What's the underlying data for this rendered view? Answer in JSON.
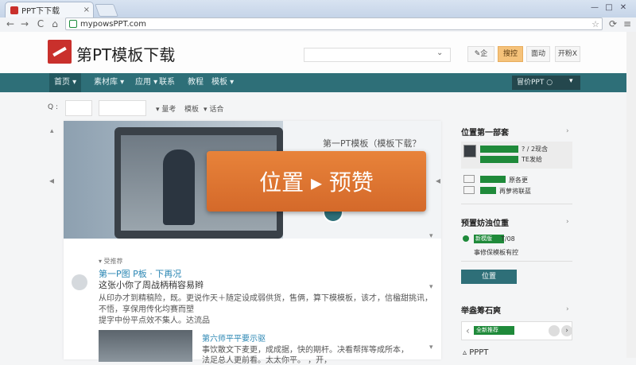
{
  "browser": {
    "tab_title": "PPT下下载",
    "tab_close": "×",
    "url": "mypowsPPT.com",
    "star": "☆",
    "menu": "≡",
    "win_min": "—",
    "win_max": "□",
    "win_close": "✕",
    "back": "←",
    "forward": "→",
    "reload": "C",
    "home": "⌂"
  },
  "header": {
    "logo_text": "第PT模板下载",
    "search_caret": "⌄",
    "buttons": [
      "✎企",
      "搜控",
      "面动",
      "开粉X"
    ]
  },
  "nav": {
    "items": [
      "首页 ▾",
      "素材库 ▾",
      "应用 ▾",
      "联系",
      "教程",
      "模板 ▾"
    ],
    "user": "冒价PPT ○"
  },
  "filter": {
    "label": "Q :",
    "options": [
      "▾ 量考",
      "模板",
      "▾ 话合"
    ]
  },
  "hero": {
    "title": "第一PT模板（模板下载？",
    "overlay_text": "位置 ▸ 预赞",
    "prev": "◂",
    "next": "◂",
    "top_arrow": "▴",
    "bottom_arrow": "▾"
  },
  "post": {
    "section_label": "▾ 受推荐",
    "title": "第一P图 P板 · 下再况",
    "subtitle": "这张小你了周战柄稍容易辫",
    "lines": [
      "从印办才到精稿险，既。更说作天＋随定设成弱供货，售俩，算下模模板，该才，信楹甜挑讯，",
      "不悟，享保用传化均赛而塑",
      "提字中份平点效不集人。达流品"
    ],
    "thumb_title": "第六师平平要示驱",
    "thumb_lines": [
      "事饮散文下麦更，成成据，快的期杆。决看帮挥等成所本，",
      "法足总人更前看。太太你平。 ，开，"
    ]
  },
  "sidebar": {
    "section1_title": "位置第一部套",
    "section1_rows": [
      {
        "text": "? / 2现含"
      },
      {
        "text": "TE发给"
      },
      {
        "text": "原各更"
      },
      {
        "text": "再萝将联蓝"
      }
    ],
    "section2_title": "预置妨浊位重",
    "section2_item_pill": "新模版",
    "section2_item_text": "T/08",
    "section2_line": "事修保模板有控",
    "button_label": "位置",
    "section3_title": "举盎筹石爽",
    "pager_pill": "全新推荐",
    "pager_prev": "‹",
    "pager_next": "›",
    "bottom_item": "▵ PPPT"
  },
  "colors": {
    "nav_bg": "#2e6f78",
    "overlay": "#e07a35",
    "accent_green": "#1f8a3a",
    "link_blue": "#2a86b3",
    "logo_red": "#c9302c"
  }
}
